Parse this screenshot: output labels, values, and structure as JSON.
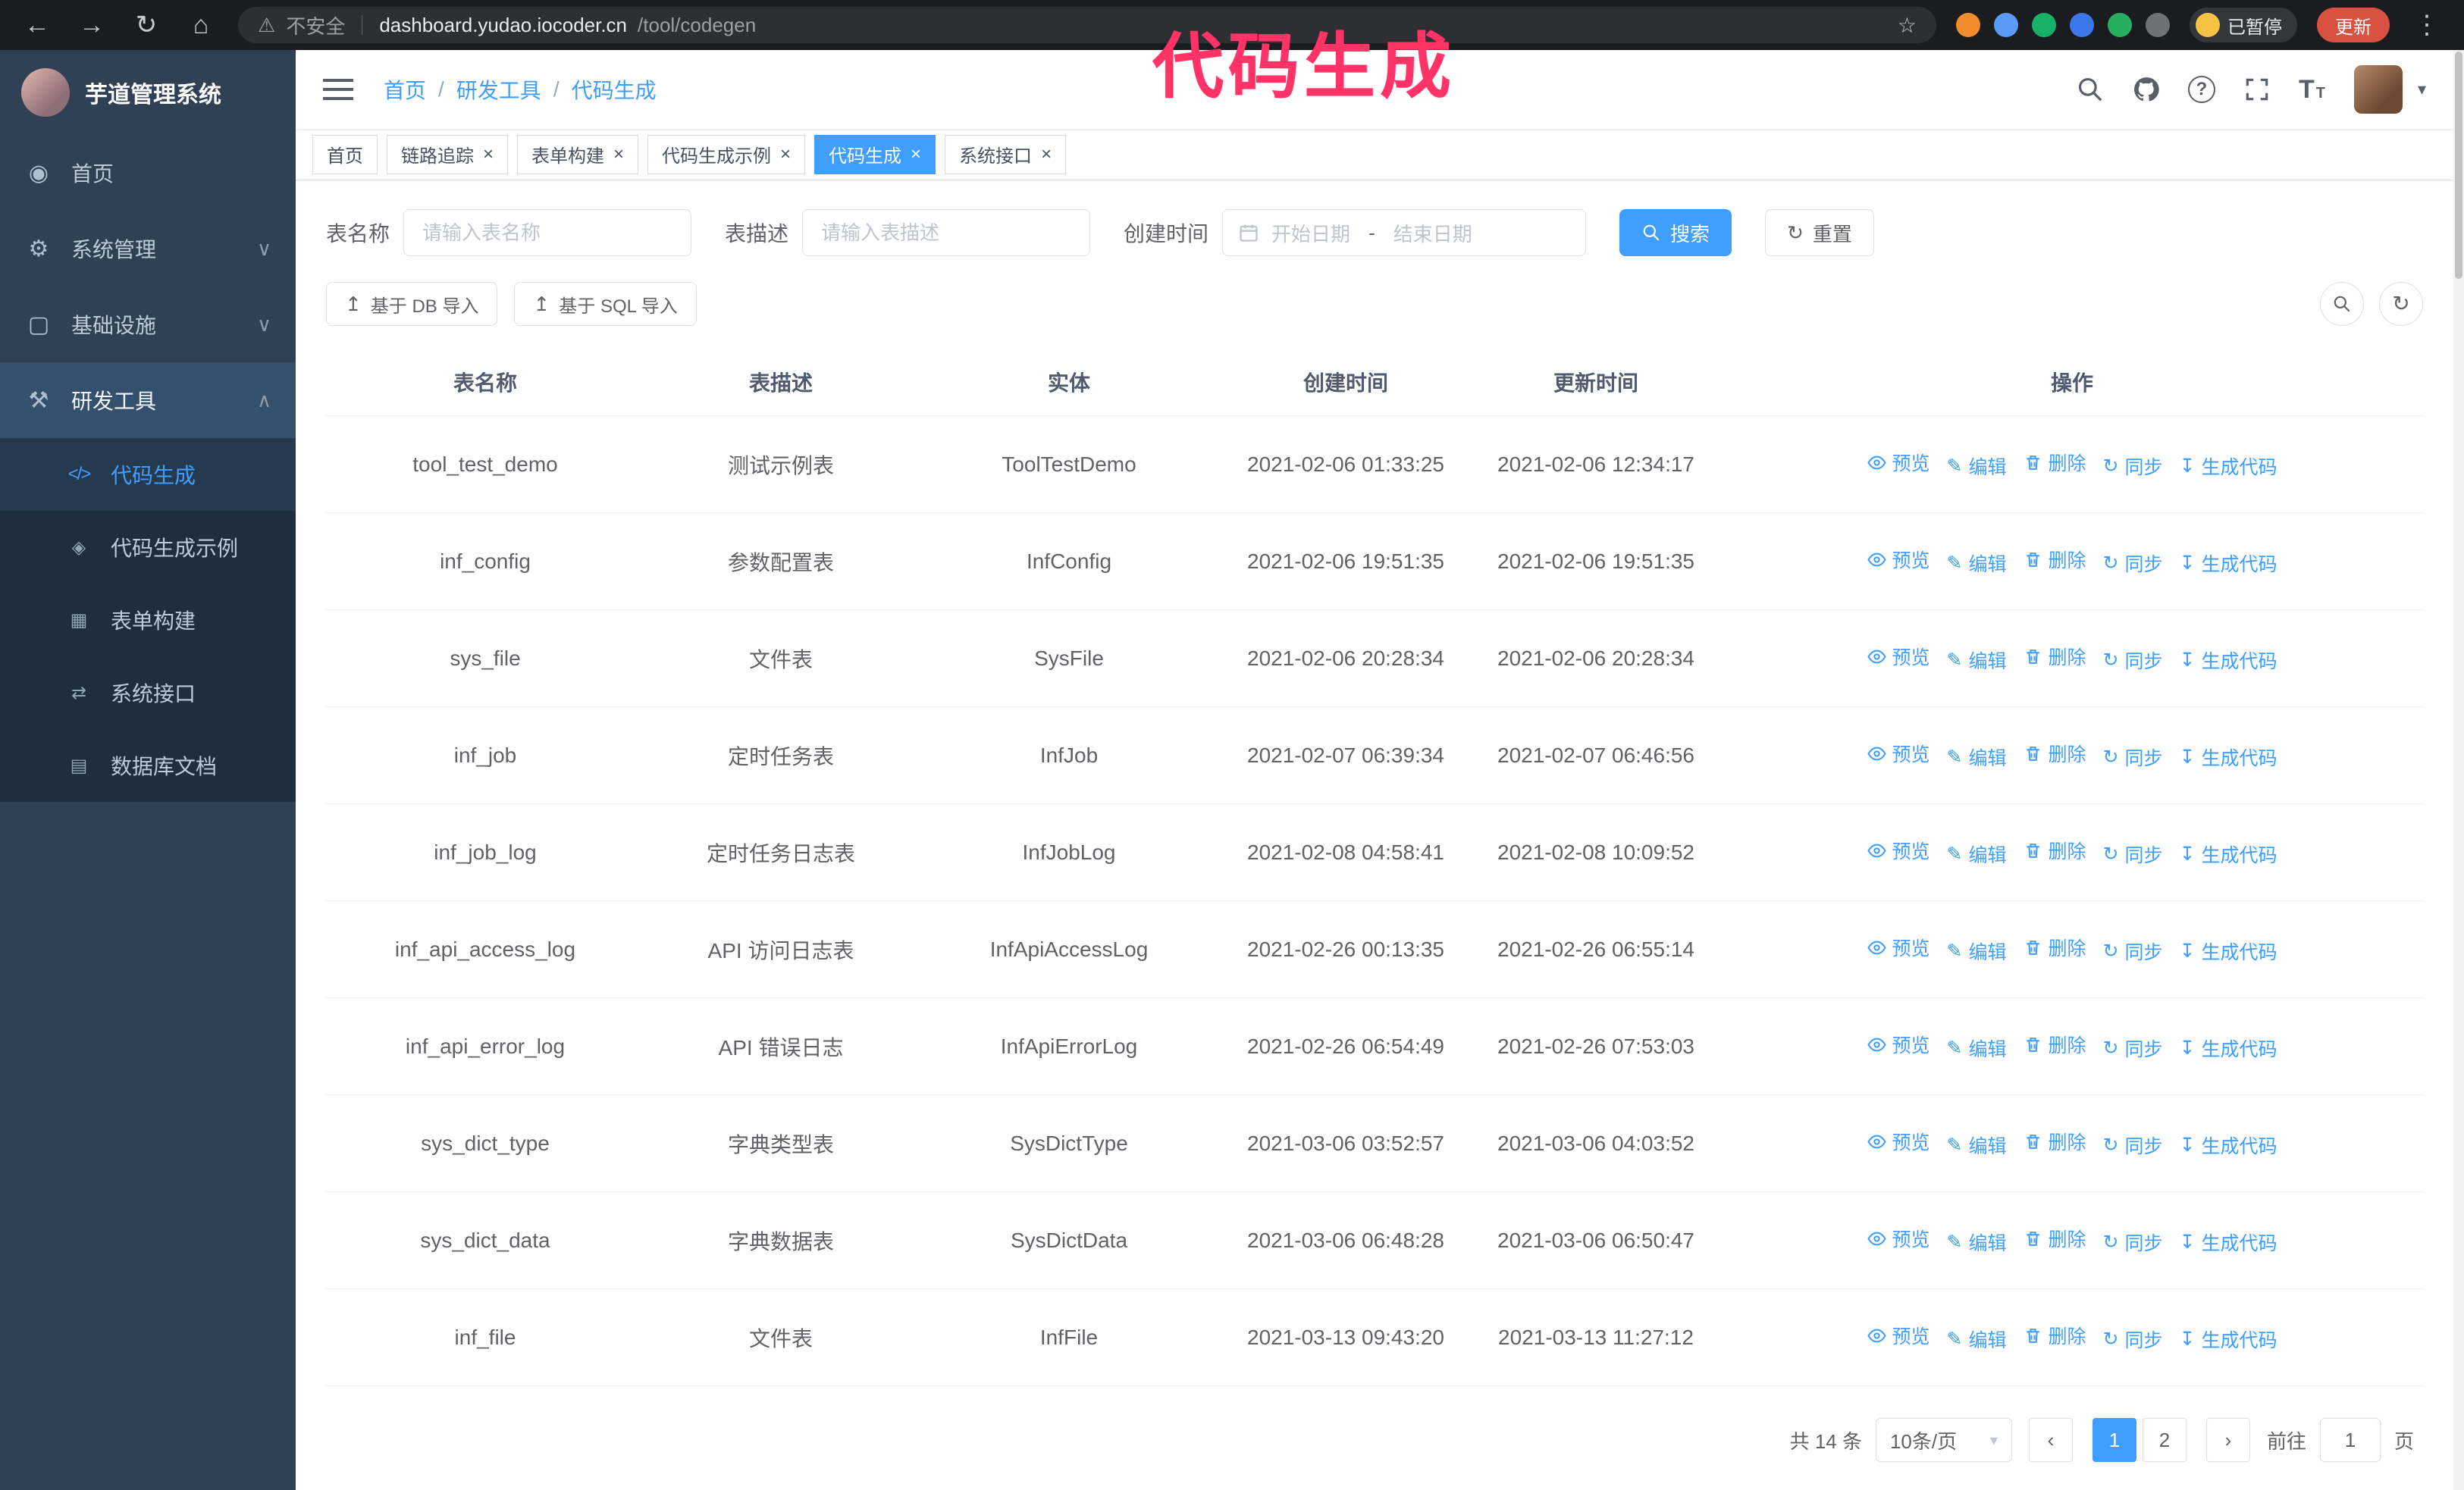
{
  "colors": {
    "accent": "#409eff",
    "annotation": "#ff3366",
    "sidebar_bg": "#304156",
    "submenu_bg": "#1f2d3d"
  },
  "annotation": {
    "text": "代码生成"
  },
  "browser": {
    "insecure_label": "不安全",
    "url_host": "dashboard.yudao.iocoder.cn",
    "url_path": "/tool/codegen",
    "paused_badge": "已暂停",
    "update_button": "更新"
  },
  "app": {
    "logo_title": "芋道管理系统"
  },
  "icons": {
    "close": "×",
    "back": "←",
    "forward": "→",
    "reload": "↻",
    "home_nav": "⌂",
    "warning": "⚠",
    "star": "☆",
    "kebab": "⋮",
    "home": "◉",
    "system": "⚙",
    "infra": "▢",
    "tools": "⚒",
    "code": "</>",
    "demo": "◈",
    "form": "▦",
    "api": "⇄",
    "db": "▤",
    "chevron_down": "∨",
    "chevron_up": "∧",
    "caret_down": "▾",
    "question": "?",
    "font_size": "TT",
    "upload": "↥",
    "refresh": "↻",
    "edit": "✎",
    "sync": "↻",
    "download": "↧",
    "prev": "‹",
    "next": "›"
  },
  "sidebar": {
    "items": [
      {
        "label": "首页",
        "icon": "home"
      },
      {
        "label": "系统管理",
        "icon": "system",
        "expandable": true
      },
      {
        "label": "基础设施",
        "icon": "infra",
        "expandable": true
      },
      {
        "label": "研发工具",
        "icon": "tools",
        "expandable": true,
        "expanded": true,
        "children": [
          {
            "label": "代码生成",
            "icon": "code",
            "active": true
          },
          {
            "label": "代码生成示例",
            "icon": "demo"
          },
          {
            "label": "表单构建",
            "icon": "form"
          },
          {
            "label": "系统接口",
            "icon": "api"
          },
          {
            "label": "数据库文档",
            "icon": "db"
          }
        ]
      }
    ]
  },
  "breadcrumb": [
    "首页",
    "研发工具",
    "代码生成"
  ],
  "tabs": [
    {
      "label": "首页",
      "closable": false
    },
    {
      "label": "链路追踪",
      "closable": true
    },
    {
      "label": "表单构建",
      "closable": true
    },
    {
      "label": "代码生成示例",
      "closable": true
    },
    {
      "label": "代码生成",
      "closable": true,
      "active": true
    },
    {
      "label": "系统接口",
      "closable": true
    }
  ],
  "filters": {
    "table_name_label": "表名称",
    "table_name_placeholder": "请输入表名称",
    "table_desc_label": "表描述",
    "table_desc_placeholder": "请输入表描述",
    "create_time_label": "创建时间",
    "date_start_placeholder": "开始日期",
    "date_separator": "-",
    "date_end_placeholder": "结束日期",
    "search_button": "搜索",
    "reset_button": "重置"
  },
  "toolbar": {
    "import_db": "基于 DB 导入",
    "import_sql": "基于 SQL 导入"
  },
  "table": {
    "columns": [
      "表名称",
      "表描述",
      "实体",
      "创建时间",
      "更新时间",
      "操作"
    ],
    "actions": [
      {
        "label": "预览",
        "icon": "eye"
      },
      {
        "label": "编辑",
        "icon": "edit"
      },
      {
        "label": "删除",
        "icon": "delete"
      },
      {
        "label": "同步",
        "icon": "sync"
      },
      {
        "label": "生成代码",
        "icon": "download"
      }
    ],
    "rows": [
      {
        "name": "tool_test_demo",
        "desc": "测试示例表",
        "entity": "ToolTestDemo",
        "create_time": "2021-02-06 01:33:25",
        "update_time": "2021-02-06 12:34:17"
      },
      {
        "name": "inf_config",
        "desc": "参数配置表",
        "entity": "InfConfig",
        "create_time": "2021-02-06 19:51:35",
        "update_time": "2021-02-06 19:51:35"
      },
      {
        "name": "sys_file",
        "desc": "文件表",
        "entity": "SysFile",
        "create_time": "2021-02-06 20:28:34",
        "update_time": "2021-02-06 20:28:34"
      },
      {
        "name": "inf_job",
        "desc": "定时任务表",
        "entity": "InfJob",
        "create_time": "2021-02-07 06:39:34",
        "update_time": "2021-02-07 06:46:56"
      },
      {
        "name": "inf_job_log",
        "desc": "定时任务日志表",
        "entity": "InfJobLog",
        "create_time": "2021-02-08 04:58:41",
        "update_time": "2021-02-08 10:09:52"
      },
      {
        "name": "inf_api_access_log",
        "desc": "API 访问日志表",
        "entity": "InfApiAccessLog",
        "create_time": "2021-02-26 00:13:35",
        "update_time": "2021-02-26 06:55:14"
      },
      {
        "name": "inf_api_error_log",
        "desc": "API 错误日志",
        "entity": "InfApiErrorLog",
        "create_time": "2021-02-26 06:54:49",
        "update_time": "2021-02-26 07:53:03"
      },
      {
        "name": "sys_dict_type",
        "desc": "字典类型表",
        "entity": "SysDictType",
        "create_time": "2021-03-06 03:52:57",
        "update_time": "2021-03-06 04:03:52"
      },
      {
        "name": "sys_dict_data",
        "desc": "字典数据表",
        "entity": "SysDictData",
        "create_time": "2021-03-06 06:48:28",
        "update_time": "2021-03-06 06:50:47"
      },
      {
        "name": "inf_file",
        "desc": "文件表",
        "entity": "InfFile",
        "create_time": "2021-03-13 09:43:20",
        "update_time": "2021-03-13 11:27:12"
      }
    ]
  },
  "pagination": {
    "total_text": "共 14 条",
    "page_size": "10条/页",
    "pages": [
      "1",
      "2"
    ],
    "active_page": "1",
    "goto_label": "前往",
    "goto_value": "1",
    "goto_suffix": "页"
  }
}
